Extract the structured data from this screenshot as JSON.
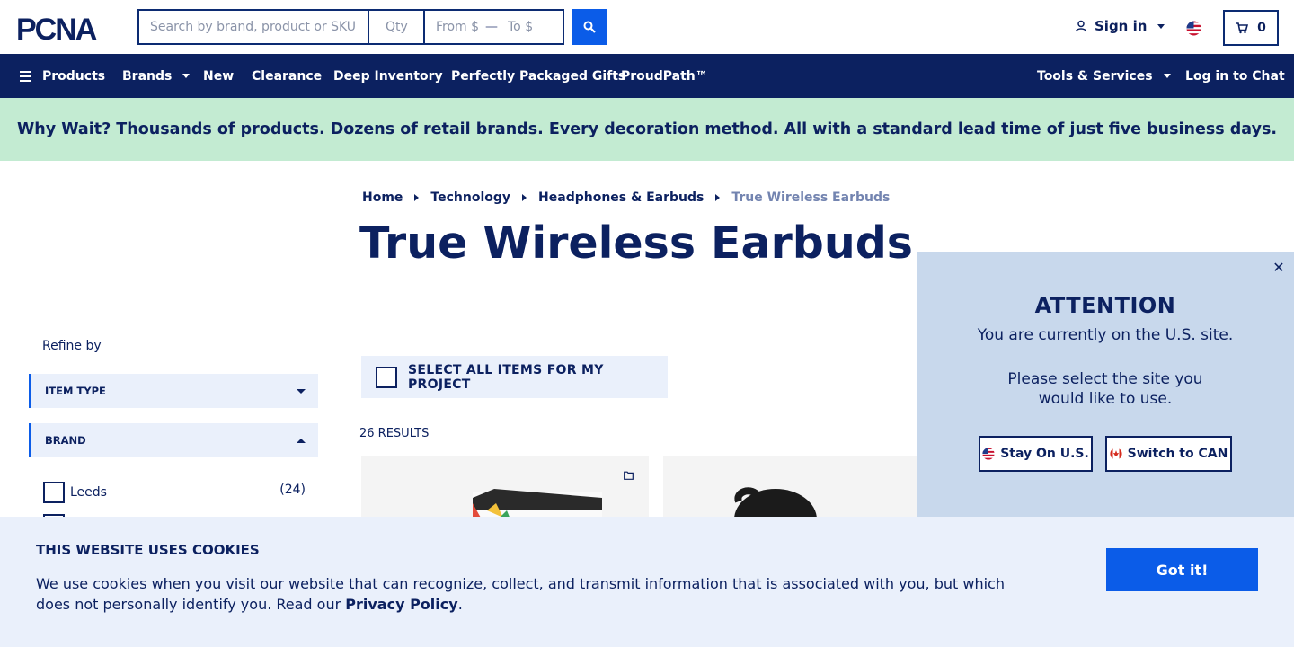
{
  "header": {
    "logo_text": "PCNA",
    "search": {
      "placeholder": "Search by brand, product or SKU",
      "value": ""
    },
    "qty": {
      "placeholder": "Qty",
      "value": ""
    },
    "price_from": {
      "placeholder": "From $",
      "value": ""
    },
    "price_sep": "—",
    "price_to": {
      "placeholder": "To $",
      "value": ""
    },
    "signin_label": "Sign in",
    "cart_count": "0",
    "search_icon": "search-icon",
    "user_icon": "user-icon",
    "cart_icon": "cart-icon",
    "flag_icon": "us-flag-icon"
  },
  "nav": {
    "items": [
      {
        "label": "Products"
      },
      {
        "label": "Brands"
      },
      {
        "label": "New"
      },
      {
        "label": "Clearance"
      },
      {
        "label": "Deep Inventory"
      },
      {
        "label": "Perfectly Packaged Gifts"
      },
      {
        "label": "ProudPath™"
      }
    ],
    "right": [
      {
        "label": "Tools & Services"
      },
      {
        "label": "Log in to Chat"
      }
    ]
  },
  "promo": {
    "text": "Why Wait? Thousands of products. Dozens of retail brands. Every decoration method. All with a standard lead time of just five business days."
  },
  "breadcrumb": [
    "Home",
    "Technology",
    "Headphones & Earbuds",
    "True Wireless Earbuds"
  ],
  "page_title": "True Wireless Earbuds",
  "sidebar": {
    "refine_label": "Refine by",
    "facets": [
      {
        "label": "ITEM TYPE",
        "expanded": false
      },
      {
        "label": "BRAND",
        "expanded": true
      }
    ],
    "brand_options": [
      {
        "label": "Leeds",
        "count": "(24)",
        "checked": false
      }
    ]
  },
  "main": {
    "select_all_label": "SELECT ALL ITEMS FOR MY PROJECT",
    "results_label": "26 RESULTS"
  },
  "attention": {
    "title": "ATTENTION",
    "line1": "You are currently on the U.S. site.",
    "line2": "Please select the site you",
    "line3": "would like to use.",
    "stay_label": "Stay On U.S.",
    "switch_label": "Switch to CAN"
  },
  "cookie": {
    "title": "THIS WEBSITE USES COOKIES",
    "text": "We use cookies when you visit our website that can recognize, collect, and transmit information that is associated with you, but which does not personally identify you. Read our ",
    "link": "Privacy Policy",
    "end": ".",
    "button": "Got it!"
  },
  "colors": {
    "navy": "#0c2160",
    "accent_blue": "#0b5ce8",
    "promo_green": "#c3ebd2",
    "panel_blue": "#c8d8ec",
    "banner_bg": "#eaf0fb"
  }
}
